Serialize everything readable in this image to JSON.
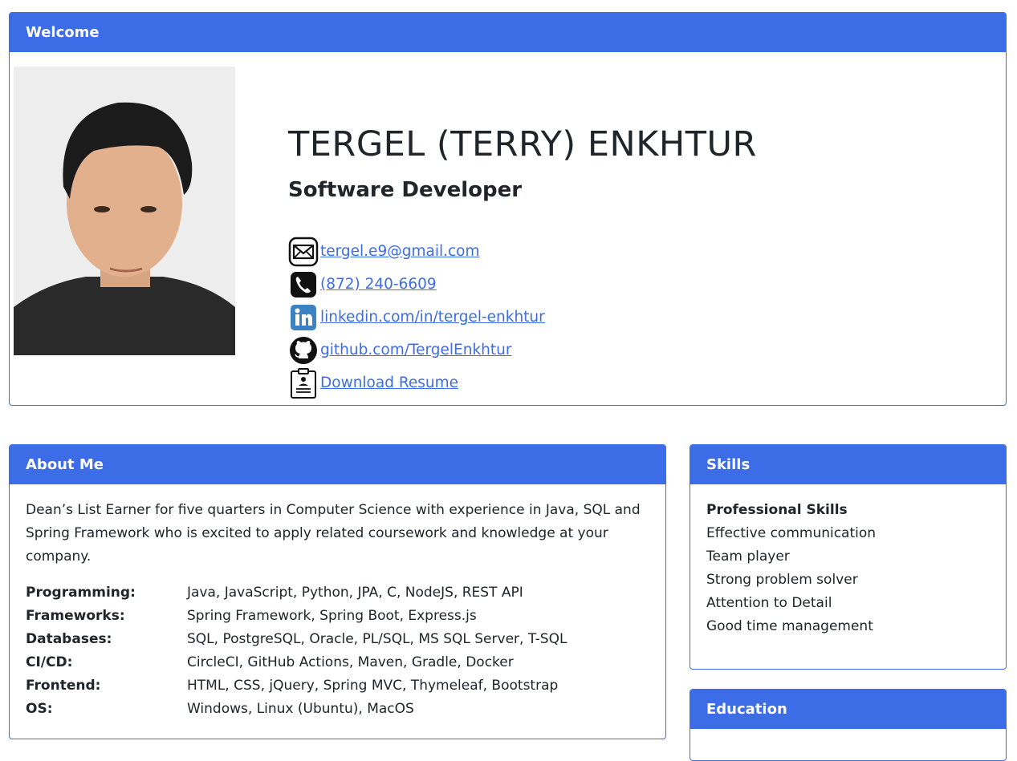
{
  "welcome": {
    "header": "Welcome",
    "name": "TERGEL (TERRY) ENKHTUR",
    "role": "Software Developer",
    "contacts": [
      {
        "icon": "email-icon",
        "text": "tergel.e9@gmail.com"
      },
      {
        "icon": "phone-icon",
        "text": "(872) 240-6609"
      },
      {
        "icon": "linkedin-icon",
        "text": "linkedin.com/in/tergel-enkhtur"
      },
      {
        "icon": "github-icon",
        "text": "github.com/TergelEnkhtur"
      },
      {
        "icon": "resume-icon",
        "text": "Download Resume"
      }
    ]
  },
  "about": {
    "header": "About Me",
    "text": "Dean’s List Earner for five quarters in Computer Science with experience in Java, SQL and Spring Framework who is excited to apply related coursework and knowledge at your company.",
    "rows": [
      {
        "key": "Programming:",
        "value": "Java, JavaScript, Python, JPA, C, NodeJS, REST API"
      },
      {
        "key": "Frameworks:",
        "value": "Spring Framework, Spring Boot, Express.js"
      },
      {
        "key": "Databases:",
        "value": "SQL, PostgreSQL, Oracle, PL/SQL, MS SQL Server, T-SQL"
      },
      {
        "key": "CI/CD:",
        "value": "CircleCI, GitHub Actions, Maven, Gradle, Docker"
      },
      {
        "key": "Frontend:",
        "value": "HTML, CSS, jQuery, Spring MVC, Thymeleaf, Bootstrap"
      },
      {
        "key": "OS:",
        "value": "Windows, Linux (Ubuntu), MacOS"
      }
    ]
  },
  "skills": {
    "header": "Skills",
    "title": "Professional Skills",
    "items": [
      "Effective communication",
      "Team player",
      "Strong problem solver",
      "Attention to Detail",
      "Good time management"
    ]
  },
  "education": {
    "header": "Education"
  },
  "colors": {
    "accent": "#3d6ce7",
    "text": "#212529"
  }
}
